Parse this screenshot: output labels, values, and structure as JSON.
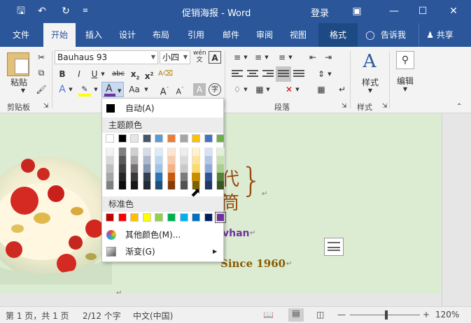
{
  "titlebar": {
    "title": "促销海报 - Word",
    "login": "登录"
  },
  "tabs": [
    "文件",
    "开始",
    "插入",
    "设计",
    "布局",
    "引用",
    "邮件",
    "审阅",
    "视图",
    "格式"
  ],
  "tell_me": "告诉我",
  "share": "共享",
  "ribbon": {
    "paste_label": "粘贴",
    "clipboard_label": "剪贴板",
    "font_name": "Bauhaus 93",
    "font_size": "小四",
    "wen_label": "wén",
    "paragraph_label": "段落",
    "styles_label": "样式",
    "styles_group_label": "样式",
    "edit_label": "编辑",
    "aa_label": "Aa"
  },
  "dropdown": {
    "auto_label": "自动(A)",
    "theme_header": "主题颜色",
    "standard_header": "标准色",
    "more_colors": "其他颜色(M)...",
    "gradient": "渐变(G)"
  },
  "colors": {
    "theme_top": [
      "#ffffff",
      "#000000",
      "#e7e6e6",
      "#44546a",
      "#5b9bd5",
      "#ed7d31",
      "#a5a5a5",
      "#ffc000",
      "#4472c4",
      "#70ad47"
    ],
    "theme_grad": [
      [
        "#f2f2f2",
        "#d9d9d9",
        "#bfbfbf",
        "#a6a6a6",
        "#808080"
      ],
      [
        "#7f7f7f",
        "#595959",
        "#404040",
        "#262626",
        "#0d0d0d"
      ],
      [
        "#d0cece",
        "#aeabab",
        "#757171",
        "#3a3838",
        "#171616"
      ],
      [
        "#d6dce4",
        "#adb9ca",
        "#8496b0",
        "#323f4f",
        "#222a35"
      ],
      [
        "#deebf6",
        "#bdd7ee",
        "#9dc3e6",
        "#2e75b5",
        "#1f4e79"
      ],
      [
        "#fbe5d5",
        "#f7cbac",
        "#f4b183",
        "#c55a11",
        "#843c0b"
      ],
      [
        "#ededed",
        "#dbdbdb",
        "#c9c9c9",
        "#7b7b7b",
        "#525252"
      ],
      [
        "#fff2cc",
        "#fee599",
        "#ffd965",
        "#bf9000",
        "#7f6000"
      ],
      [
        "#d9e2f3",
        "#b4c6e7",
        "#8eaadb",
        "#2f5496",
        "#1f3864"
      ],
      [
        "#e2efd9",
        "#c5e0b3",
        "#a8d08d",
        "#538135",
        "#375623"
      ]
    ],
    "standard": [
      "#c00000",
      "#ff0000",
      "#ffc000",
      "#ffff00",
      "#92d050",
      "#00b050",
      "#00b0f0",
      "#0070c0",
      "#002060",
      "#7030a0"
    ]
  },
  "document": {
    "heading_1": "代",
    "heading_2": "筒",
    "brace": "}",
    "subtitle": "vhan",
    "since": "Since 1960"
  },
  "status": {
    "page": "第 1 页，共 1 页",
    "words": "2/12 个字",
    "lang": "中文(中国)",
    "zoom": "120%"
  }
}
